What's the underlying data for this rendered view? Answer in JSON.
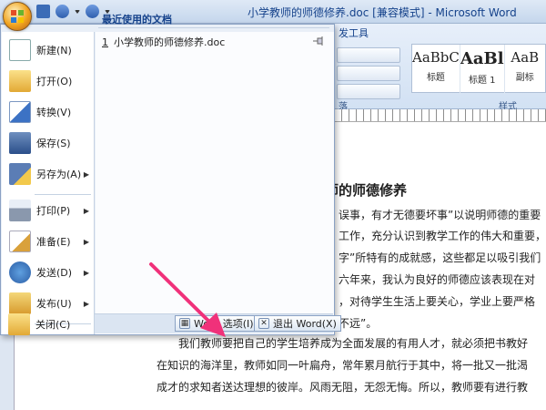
{
  "window": {
    "title": "小学教师的师德修养.doc [兼容模式] - Microsoft Word"
  },
  "ribbon": {
    "tab_developer": "发工具",
    "paragraph_group_label": "落",
    "styles_group_label": "样式",
    "styles": [
      {
        "sample": "AaBbC",
        "name": "标题"
      },
      {
        "sample": "AaBl",
        "name": "标题 1"
      },
      {
        "sample": "AaB",
        "name": "副标"
      }
    ]
  },
  "office_menu": {
    "items": [
      {
        "label": "新建(N)",
        "icon": "new-document-icon"
      },
      {
        "label": "打开(O)",
        "icon": "open-folder-icon"
      },
      {
        "label": "转换(V)",
        "icon": "convert-icon"
      },
      {
        "label": "保存(S)",
        "icon": "save-disk-icon"
      },
      {
        "label": "另存为(A)",
        "icon": "save-as-icon",
        "has_submenu": true
      },
      {
        "label": "打印(P)",
        "icon": "printer-icon",
        "has_submenu": true
      },
      {
        "label": "准备(E)",
        "icon": "prepare-icon",
        "has_submenu": true
      },
      {
        "label": "发送(D)",
        "icon": "send-icon",
        "has_submenu": true
      },
      {
        "label": "发布(U)",
        "icon": "publish-icon",
        "has_submenu": true
      },
      {
        "label": "关闭(C)",
        "icon": "close-folder-icon"
      }
    ],
    "recent_header": "最近使用的文档",
    "recent_files": [
      {
        "num": "1",
        "name": "小学教师的师德修养.doc"
      }
    ],
    "word_options_label": "Word 选项(I)",
    "exit_word_label": "退出 Word(X)"
  },
  "document": {
    "heading": "师的师德修养",
    "lines": [
      "误事，有才无德要坏事”以说明师德的重要",
      "工作，充分认识到教学工作的伟大和重要，",
      "字”所特有的成就感，这些都足以吸引我们",
      "六年来，我认为良好的师德应该表现在对",
      "，对待学生生活上要关心，学业上要严格",
      "不远”。",
      "我们教师要把自己的学生培养成为全面发展的有用人才，就必须把书教好",
      "在知识的海洋里，教师如同一叶扁舟，常年累月航行于其中，将一批又一批渴",
      "成才的求知者送达理想的彼岸。风雨无阻，无怨无悔。所以，教师要有进行教"
    ]
  },
  "colors": {
    "annotation_arrow": "#f0317a",
    "title_text": "#15428b"
  }
}
